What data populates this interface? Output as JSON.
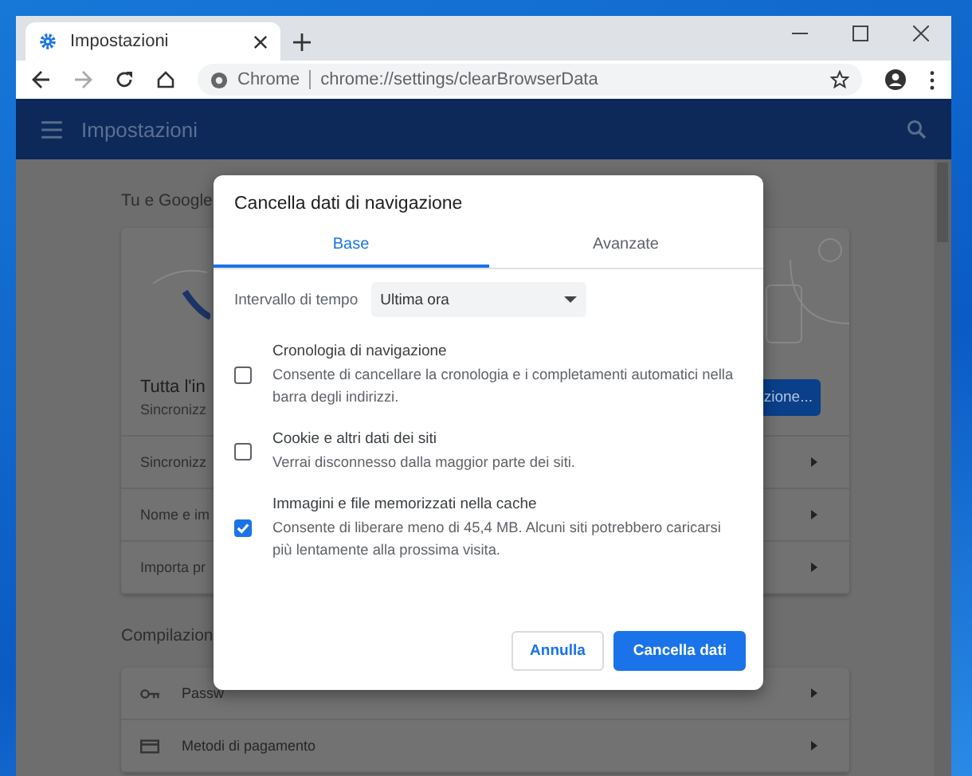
{
  "browser": {
    "tab_title": "Impostazioni",
    "site_label": "Chrome",
    "url": "chrome://settings/clearBrowserData"
  },
  "header": {
    "title": "Impostazioni"
  },
  "page": {
    "section_title": "Tu e Google",
    "account_title": "Tutta l'in",
    "account_subtitle": "Sincronizz",
    "account_button": "zione...",
    "rows": [
      "Sincronizz",
      "Nome e im",
      "Importa pr"
    ],
    "autofill_title": "Compilazion",
    "autofill_rows": [
      {
        "kind": "key",
        "label": "Passw"
      },
      {
        "kind": "card",
        "label": "Metodi di pagamento"
      }
    ]
  },
  "dialog": {
    "title": "Cancella dati di navigazione",
    "tabs": [
      {
        "label": "Base",
        "selected": true
      },
      {
        "label": "Avanzate",
        "selected": false
      }
    ],
    "time_range": {
      "label": "Intervallo di tempo",
      "value": "Ultima ora"
    },
    "items": [
      {
        "title": "Cronologia di navigazione",
        "description": "Consente di cancellare la cronologia e i completamenti automatici nella barra degli indirizzi.",
        "checked": false
      },
      {
        "title": "Cookie e altri dati dei siti",
        "description": "Verrai disconnesso dalla maggior parte dei siti.",
        "checked": false
      },
      {
        "title": "Immagini e file memorizzati nella cache",
        "description": "Consente di liberare meno di 45,4 MB. Alcuni siti potrebbero caricarsi più lentamente alla prossima visita.",
        "checked": true
      }
    ],
    "buttons": [
      {
        "label": "Annulla",
        "kind": "secondary"
      },
      {
        "label": "Cancella dati",
        "kind": "primary"
      }
    ]
  }
}
